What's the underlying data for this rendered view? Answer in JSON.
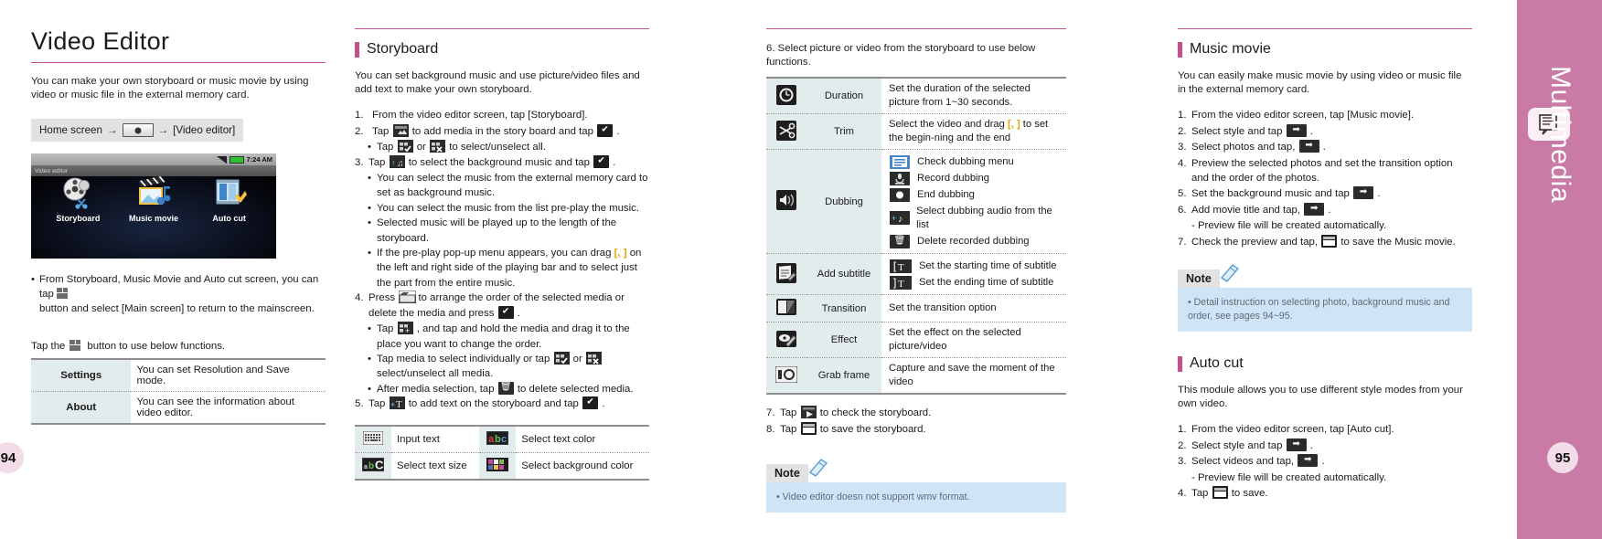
{
  "sidebar": {
    "label": "Multimedia",
    "icon": "book-note-icon",
    "color": "#c97ba6"
  },
  "page_numbers": {
    "left": "94",
    "right": "95"
  },
  "col1": {
    "title": "Video Editor",
    "intro": "You can make your own storyboard or music movie by using video or music file in the external memory card.",
    "path": {
      "prefix": "Home screen",
      "arrow1": "→",
      "arrow2": "→",
      "target": "[Video editor]"
    },
    "screenshot": {
      "clock": "7:24 AM",
      "app_title": "Video editor",
      "icons": [
        {
          "label": "Storyboard",
          "icon": "film-reel-scissors-icon"
        },
        {
          "label": "Music movie",
          "icon": "clapboard-music-icon"
        },
        {
          "label": "Auto cut",
          "icon": "auto-cut-icon"
        }
      ]
    },
    "bullet": "From Storyboard, Music Movie and Auto cut screen, you can tap",
    "bullet_cont": "button and select [Main screen] to return to the mainscreen.",
    "tap_line_pre": "Tap the",
    "tap_line_post": "button to use below functions.",
    "table": [
      {
        "label": "Settings",
        "desc": "You can set Resolution and Save mode."
      },
      {
        "label": "About",
        "desc": "You can see the information about video editor."
      }
    ]
  },
  "col2": {
    "title": "Storyboard",
    "intro": "You can set background music and use picture/video files and add text to make your own storyboard.",
    "steps": [
      {
        "n": "1.",
        "parts": [
          "From the video editor screen, tap [Storyboard]."
        ]
      },
      {
        "n": "2.",
        "pre": "Tap",
        "icons": [
          "add-media-icon"
        ],
        "mid": "to add media in the story board and tap",
        "icons2": [
          "check-icon"
        ],
        "post": "."
      },
      {
        "n": "3.",
        "pre": "Tap",
        "icons": [
          "music-note-icon"
        ],
        "mid": "to select the background music and tap",
        "icons2": [
          "check-icon"
        ],
        "post": "."
      },
      {
        "n": "4.",
        "pre": "Press",
        "icons": [
          "folder-icon"
        ],
        "mid": "to arrange the order of the selected media or delete the media and press",
        "icons2": [
          "check-icon"
        ],
        "post": "."
      },
      {
        "n": "5.",
        "pre": "Tap",
        "icons": [
          "add-text-icon"
        ],
        "mid": "to add text on the storyboard and tap",
        "icons2": [
          "check-icon"
        ],
        "post": "."
      }
    ],
    "sub_2": {
      "pre": "Tap",
      "or": "or",
      "post": "to select/unselect all."
    },
    "sub_3": [
      "You can select the music from the external memory card to set as background music.",
      "You can select the music from the list pre-play the music.",
      "Selected music will be played up to the length of the storyboard."
    ],
    "sub_3_drag": {
      "pre": "If the pre-play pop-up menu appears, you can drag",
      "marker": "[, ]",
      "post": "on the left and right side of the playing bar and to select just the part from the entire music."
    },
    "sub_4": [
      {
        "pre": "Tap",
        "post": ", and tap and hold the media and drag it to the place you want to change the order."
      },
      {
        "pre": "Tap media to select individually or tap",
        "or": "or",
        "post": "select/unselect all media."
      },
      {
        "pre": "After media selection, tap",
        "post": "to delete selected media."
      }
    ],
    "text_table": [
      {
        "icon": "keyboard-icon",
        "label": "Input text",
        "icon2": "abc-color-icon",
        "label2": "Select text color"
      },
      {
        "icon": "abc-size-icon",
        "label": "Select text size",
        "icon2": "palette-icon",
        "label2": "Select background color"
      }
    ]
  },
  "col3": {
    "step6": "6. Select picture or video from the storyboard to use below functions.",
    "table": [
      {
        "icon": "clock-icon",
        "name": "Duration",
        "desc": "Set the duration of the selected picture from 1~30 seconds.",
        "subs": []
      },
      {
        "icon": "scissors-icon",
        "name": "Trim",
        "desc_pre": "Select the video and drag",
        "marker": "[, ]",
        "desc_post": "to set the begin-ning and the end",
        "subs": []
      },
      {
        "icon": "speaker-icon",
        "name": "Dubbing",
        "subs": [
          {
            "icon": "dubbing-menu-icon",
            "text": "Check dubbing menu"
          },
          {
            "icon": "microphone-icon",
            "text": "Record dubbing"
          },
          {
            "icon": "record-stop-icon",
            "text": "End dubbing"
          },
          {
            "icon": "add-audio-icon",
            "text": "Select dubbing audio from the list"
          },
          {
            "icon": "trash-icon",
            "text": "Delete recorded dubbing"
          }
        ]
      },
      {
        "icon": "subtitle-icon",
        "name": "Add subtitle",
        "subs": [
          {
            "icon": "start-time-icon",
            "text": "Set the starting time of subtitle"
          },
          {
            "icon": "end-time-icon",
            "text": "Set the ending time of subtitle"
          }
        ]
      },
      {
        "icon": "transition-icon",
        "name": "Transition",
        "desc": "Set the transition option",
        "subs": []
      },
      {
        "icon": "effect-icon",
        "name": "Effect",
        "desc": "Set the effect on the selected picture/video",
        "subs": []
      },
      {
        "icon": "grab-frame-icon",
        "name": "Grab frame",
        "desc": "Capture and save the moment of the video",
        "subs": []
      }
    ],
    "step7": {
      "n": "7.",
      "pre": "Tap",
      "post": "to check the storyboard."
    },
    "step8": {
      "n": "8.",
      "pre": "Tap",
      "post": "to save the storyboard."
    },
    "note": {
      "label": "Note",
      "body": "• Video editor doesn not support wmv format."
    }
  },
  "col4": {
    "music": {
      "title": "Music movie",
      "intro": "You can easily make music movie by using video or music file in the external memory card.",
      "steps": [
        {
          "n": "1.",
          "text": "From the video editor screen, tap [Music movie]."
        },
        {
          "n": "2.",
          "pre": "Select style and tap",
          "post": "."
        },
        {
          "n": "3.",
          "pre": "Select photos and tap,",
          "post": "."
        },
        {
          "n": "4.",
          "text": "Preview the selected photos and set the transition option and the order of the photos."
        },
        {
          "n": "5.",
          "pre": "Set the background music and tap",
          "post": "."
        },
        {
          "n": "6.",
          "pre": "Add movie title and tap,",
          "post": "."
        },
        {
          "n": "",
          "text": "- Preview file will be created automatically."
        },
        {
          "n": "7.",
          "pre": "Check the preview and tap,",
          "post": "to save the Music movie."
        }
      ],
      "note": {
        "label": "Note",
        "body": "• Detail instruction on selecting photo, background music and order, see pages 94~95."
      }
    },
    "autocut": {
      "title": "Auto cut",
      "intro": "This module allows you to use different style modes from your own video.",
      "steps": [
        {
          "n": "1.",
          "text": "From the video editor screen, tap [Auto cut]."
        },
        {
          "n": "2.",
          "pre": "Select style and tap",
          "post": "."
        },
        {
          "n": "3.",
          "pre": "Select videos and tap,",
          "post": "."
        },
        {
          "n": "",
          "text": "- Preview file will be created automatically."
        },
        {
          "n": "4.",
          "pre": "Tap",
          "post": "to save."
        }
      ]
    }
  }
}
